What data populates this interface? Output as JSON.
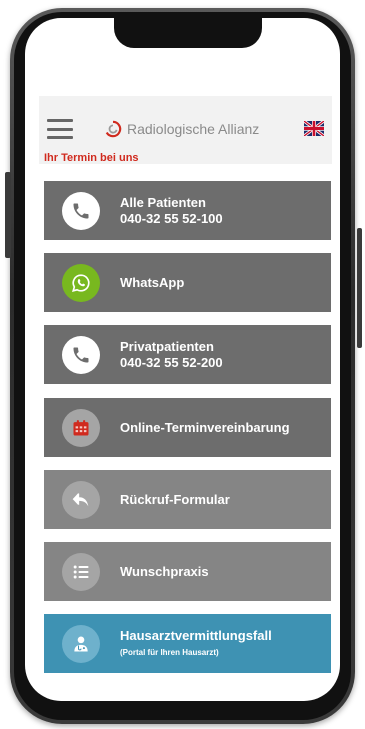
{
  "header": {
    "brand_name": "Radiologische Allianz",
    "menu_icon": "hamburger-menu-icon",
    "language_icon": "uk-flag-icon"
  },
  "subtitle": "Ihr Termin bei uns",
  "buttons": [
    {
      "line1": "Alle Patienten",
      "line2": "040-32 55 52-100",
      "icon": "phone-icon"
    },
    {
      "line1": "WhatsApp",
      "icon": "whatsapp-icon"
    },
    {
      "line1": "Privatpatienten",
      "line2": "040-32 55 52-200",
      "icon": "phone-icon"
    },
    {
      "line1": "Online-Terminvereinbarung",
      "icon": "calendar-icon"
    },
    {
      "line1": "Rückruf-Formular",
      "icon": "reply-icon"
    },
    {
      "line1": "Wunschpraxis",
      "icon": "list-icon"
    },
    {
      "line1": "Hausarztvermittlungsfall",
      "line2": "(Portal für Ihren Hausarzt)",
      "icon": "doctor-icon"
    }
  ],
  "colors": {
    "accent_red": "#d02a1e",
    "button_dark": "#6d6d6d",
    "button_mid": "#858585",
    "button_blue": "#3e92b3",
    "whatsapp_green": "#78b81f"
  }
}
